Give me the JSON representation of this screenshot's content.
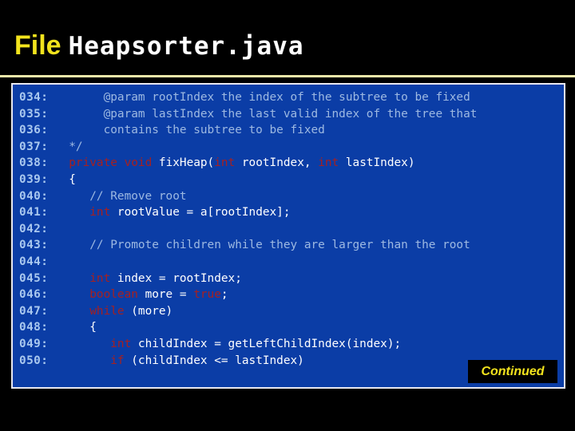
{
  "slide": {
    "title": {
      "label": "File",
      "filename": "Heapsorter.java"
    },
    "badge": {
      "label": "Continued"
    },
    "colors": {
      "background": "#000000",
      "panel": "#0b3da6",
      "panel_border": "#e8e8f0",
      "divider": "#efe9aa",
      "accent_yellow": "#f2e31d",
      "line_number": "#a9c8ef",
      "comment": "#9db9e2",
      "keyword": "#a62020",
      "code_text": "#ffffff"
    },
    "code": {
      "lines": [
        {
          "num": "034:",
          "tokens": [
            {
              "t": "        ",
              "c": "txt"
            },
            {
              "t": "@param rootIndex the index of the subtree to be fixed",
              "c": "cmt"
            }
          ]
        },
        {
          "num": "035:",
          "tokens": [
            {
              "t": "        ",
              "c": "txt"
            },
            {
              "t": "@param lastIndex the last valid index of the tree that",
              "c": "cmt"
            }
          ]
        },
        {
          "num": "036:",
          "tokens": [
            {
              "t": "        ",
              "c": "txt"
            },
            {
              "t": "contains the subtree to be fixed",
              "c": "cmt"
            }
          ]
        },
        {
          "num": "037:",
          "tokens": [
            {
              "t": "   ",
              "c": "txt"
            },
            {
              "t": "*/",
              "c": "cmt"
            }
          ]
        },
        {
          "num": "038:",
          "tokens": [
            {
              "t": "   ",
              "c": "txt"
            },
            {
              "t": "private",
              "c": "kw"
            },
            {
              "t": " ",
              "c": "txt"
            },
            {
              "t": "void",
              "c": "kw"
            },
            {
              "t": " fixHeap(",
              "c": "txt"
            },
            {
              "t": "int",
              "c": "kw"
            },
            {
              "t": " rootIndex, ",
              "c": "txt"
            },
            {
              "t": "int",
              "c": "kw"
            },
            {
              "t": " lastIndex)",
              "c": "txt"
            }
          ]
        },
        {
          "num": "039:",
          "tokens": [
            {
              "t": "   {",
              "c": "txt"
            }
          ]
        },
        {
          "num": "040:",
          "tokens": [
            {
              "t": "      ",
              "c": "txt"
            },
            {
              "t": "// Remove root",
              "c": "cmt"
            }
          ]
        },
        {
          "num": "041:",
          "tokens": [
            {
              "t": "      ",
              "c": "txt"
            },
            {
              "t": "int",
              "c": "kw"
            },
            {
              "t": " rootValue = a[rootIndex];",
              "c": "txt"
            }
          ]
        },
        {
          "num": "042:",
          "tokens": [
            {
              "t": "",
              "c": "txt"
            }
          ]
        },
        {
          "num": "043:",
          "tokens": [
            {
              "t": "      ",
              "c": "txt"
            },
            {
              "t": "// Promote children while they are larger than the root",
              "c": "cmt"
            }
          ]
        },
        {
          "num": "044:",
          "tokens": [
            {
              "t": "",
              "c": "txt"
            }
          ]
        },
        {
          "num": "045:",
          "tokens": [
            {
              "t": "      ",
              "c": "txt"
            },
            {
              "t": "int",
              "c": "kw"
            },
            {
              "t": " index = rootIndex;",
              "c": "txt"
            }
          ]
        },
        {
          "num": "046:",
          "tokens": [
            {
              "t": "      ",
              "c": "txt"
            },
            {
              "t": "boolean",
              "c": "kw"
            },
            {
              "t": " more = ",
              "c": "txt"
            },
            {
              "t": "true",
              "c": "kw"
            },
            {
              "t": ";",
              "c": "txt"
            }
          ]
        },
        {
          "num": "047:",
          "tokens": [
            {
              "t": "      ",
              "c": "txt"
            },
            {
              "t": "while",
              "c": "kw"
            },
            {
              "t": " (more)",
              "c": "txt"
            }
          ]
        },
        {
          "num": "048:",
          "tokens": [
            {
              "t": "      {",
              "c": "txt"
            }
          ]
        },
        {
          "num": "049:",
          "tokens": [
            {
              "t": "         ",
              "c": "txt"
            },
            {
              "t": "int",
              "c": "kw"
            },
            {
              "t": " childIndex = getLeftChildIndex(index);",
              "c": "txt"
            }
          ]
        },
        {
          "num": "050:",
          "tokens": [
            {
              "t": "         ",
              "c": "txt"
            },
            {
              "t": "if",
              "c": "kw"
            },
            {
              "t": " (childIndex <= lastIndex)",
              "c": "txt"
            }
          ]
        }
      ]
    }
  }
}
